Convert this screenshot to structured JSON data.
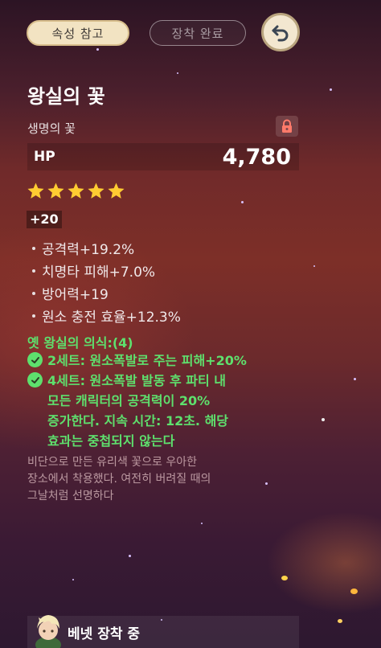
{
  "header": {
    "reference_label": "속성 참고",
    "equip_done_label": "장착 완료"
  },
  "artifact": {
    "name": "왕실의 꽃",
    "slot_type": "생명의 꽃",
    "main_stat": {
      "name": "HP",
      "value": "4,780"
    },
    "rarity_stars": 5,
    "level": "+20",
    "substats": [
      "공격력+19.2%",
      "치명타 피해+7.0%",
      "방어력+19",
      "원소 충전 효율+12.3%"
    ],
    "set": {
      "name": "옛 왕실의 의식:(4)",
      "bonuses": [
        {
          "lines": [
            "2세트: 원소폭발로 주는 피해+20%"
          ]
        },
        {
          "lines": [
            "4세트: 원소폭발 발동 후 파티 내",
            "모든 캐릭터의 공격력이 20%",
            "증가한다. 지속 시간: 12초. 해당",
            "효과는 중첩되지 않는다"
          ]
        }
      ]
    },
    "lore": [
      "비단으로 만든 유리색 꽃으로 우아한",
      "장소에서 착용했다. 여전히 버려질 때의",
      "그날처럼 선명하다"
    ]
  },
  "footer": {
    "equipped_by": "베넷 장착 중"
  },
  "colors": {
    "set_green": "#5ee06d",
    "star_gold": "#ffcc32",
    "pill_cream": "#f2e3c2"
  },
  "icons": {
    "back": "back-arrow-icon",
    "lock": "lock-icon",
    "check": "check-circle-icon",
    "star": "star-icon"
  }
}
